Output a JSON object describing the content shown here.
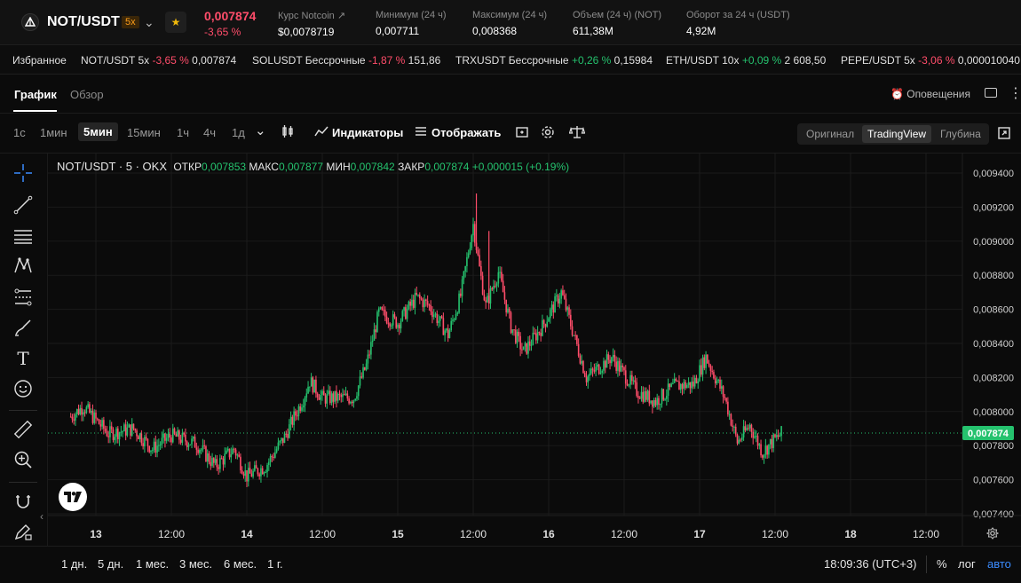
{
  "header": {
    "pair": "NOT/USDT",
    "leverage": "5x",
    "price": "0,007874",
    "change": "-3,65 %",
    "stats": [
      {
        "label": "Курс Notcoin",
        "value": "$0,0078719"
      },
      {
        "label": "Минимум (24 ч)",
        "value": "0,007711"
      },
      {
        "label": "Максимум (24 ч)",
        "value": "0,008368"
      },
      {
        "label": "Объем (24 ч) (NOT)",
        "value": "611,38M"
      },
      {
        "label": "Оборот за 24 ч (USDT)",
        "value": "4,92M"
      }
    ]
  },
  "favorites": {
    "title": "Избранное",
    "items": [
      {
        "name": "NOT/USDT 5x",
        "change": "-3,65 %",
        "price": "0,007874",
        "dir": "neg"
      },
      {
        "name": "SOLUSDT Бессрочные",
        "change": "-1,87 %",
        "price": "151,86",
        "dir": "neg"
      },
      {
        "name": "TRXUSDT Бессрочные",
        "change": "+0,26 %",
        "price": "0,15984",
        "dir": "pos"
      },
      {
        "name": "ETH/USDT 10x",
        "change": "+0,09 %",
        "price": "2 608,50",
        "dir": "pos"
      },
      {
        "name": "PEPE/USDT 5x",
        "change": "-3,06 %",
        "price": "0,000010040",
        "dir": "neg"
      }
    ]
  },
  "tabs": {
    "chart": "График",
    "overview": "Обзор",
    "alerts": "Оповещения"
  },
  "toolbar": {
    "timeframes": [
      "1с",
      "1мин",
      "5мин",
      "15мин",
      "1ч",
      "4ч",
      "1д"
    ],
    "active_timeframe": "5мин",
    "indicators": "Индикаторы",
    "display": "Отображать",
    "views": [
      "Оригинал",
      "TradingView",
      "Глубина"
    ],
    "active_view": "TradingView"
  },
  "legend": {
    "symbol": "NOT/USDT · 5 · OKX",
    "open_label": "ОТКР",
    "open": "0,007853",
    "high_label": "МАКС",
    "high": "0,007877",
    "low_label": "МИН",
    "low": "0,007842",
    "close_label": "ЗАКР",
    "close": "0,007874",
    "delta": "+0,000015 (+0.19%)"
  },
  "bottom": {
    "ranges": [
      "1 дн.",
      "5 дн.",
      "1 мес.",
      "3 мес.",
      "6 мес.",
      "1 г."
    ],
    "time": "18:09:36 (UTC+3)",
    "percent": "%",
    "log": "лог",
    "auto": "авто"
  },
  "colors": {
    "up": "#25c26e",
    "down": "#ff4d6a",
    "accent": "#3b8cff",
    "brand": "#ff9f1a"
  },
  "chart_data": {
    "type": "candlestick",
    "title": "",
    "xlabel": "",
    "ylabel": "",
    "ylim": [
      0.0073,
      0.0095
    ],
    "yticks": [
      "0,009400",
      "0,009200",
      "0,009000",
      "0,008800",
      "0,008600",
      "0,008400",
      "0,008200",
      "0,008000",
      "0,007800",
      "0,007600",
      "0,007400"
    ],
    "ytick_values": [
      0.0094,
      0.0092,
      0.009,
      0.0088,
      0.0086,
      0.0084,
      0.0082,
      0.008,
      0.0078,
      0.0076,
      0.0074
    ],
    "xticks": [
      "13",
      "12:00",
      "14",
      "12:00",
      "15",
      "12:00",
      "16",
      "12:00",
      "17",
      "12:00",
      "18",
      "12:00"
    ],
    "xtick_hours": [
      0,
      12,
      24,
      36,
      48,
      60,
      72,
      84,
      96,
      108,
      120,
      132
    ],
    "x_start_hour": -4,
    "x_end_hour": 140,
    "last_price": 0.007874,
    "last_price_label": "0,007874",
    "path_points": [
      [
        -4,
        0.00797
      ],
      [
        -2,
        0.00803
      ],
      [
        2,
        0.00787
      ],
      [
        6,
        0.0079
      ],
      [
        9,
        0.00778
      ],
      [
        12,
        0.00786
      ],
      [
        16,
        0.00781
      ],
      [
        19,
        0.00768
      ],
      [
        22,
        0.00778
      ],
      [
        24,
        0.00762
      ],
      [
        27,
        0.00768
      ],
      [
        30,
        0.00785
      ],
      [
        33,
        0.00808
      ],
      [
        34,
        0.00818
      ],
      [
        36,
        0.00808
      ],
      [
        41,
        0.00808
      ],
      [
        43,
        0.00827
      ],
      [
        45,
        0.00858
      ],
      [
        48,
        0.00852
      ],
      [
        51,
        0.00867
      ],
      [
        53,
        0.00862
      ],
      [
        56,
        0.00845
      ],
      [
        58,
        0.00868
      ],
      [
        60,
        0.0091
      ],
      [
        61,
        0.00884
      ],
      [
        62,
        0.00862
      ],
      [
        64,
        0.00882
      ],
      [
        66,
        0.0085
      ],
      [
        68,
        0.00835
      ],
      [
        71,
        0.0085
      ],
      [
        74,
        0.0087
      ],
      [
        76,
        0.00845
      ],
      [
        78,
        0.0082
      ],
      [
        82,
        0.00832
      ],
      [
        86,
        0.00812
      ],
      [
        89,
        0.00806
      ],
      [
        92,
        0.00815
      ],
      [
        95,
        0.00816
      ],
      [
        97,
        0.00832
      ],
      [
        100,
        0.00808
      ],
      [
        102,
        0.00782
      ],
      [
        104,
        0.00792
      ],
      [
        106,
        0.00776
      ],
      [
        107.5,
        0.00782
      ],
      [
        109,
        0.00787
      ]
    ],
    "spikes": [
      [
        60.5,
        0.00928
      ],
      [
        62.5,
        0.00906
      ]
    ]
  }
}
